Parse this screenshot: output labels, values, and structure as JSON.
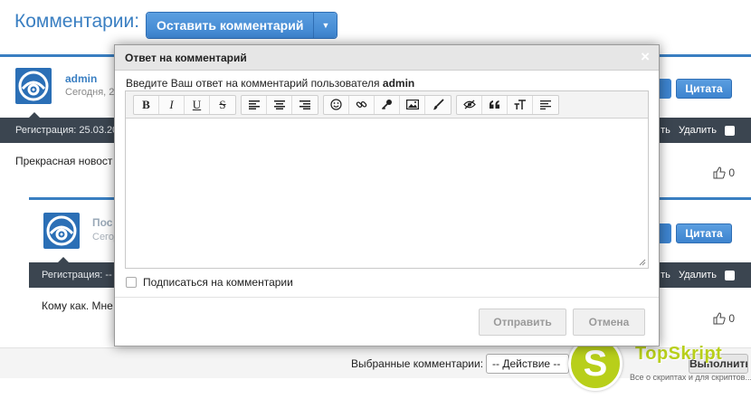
{
  "header": {
    "title": "Комментарии:",
    "add_comment_label": "Оставить комментарий"
  },
  "comments": [
    {
      "author": "admin",
      "date": "Сегодня, 2",
      "quote_label": "Цитата",
      "registration": "Регистрация: 25.03.20",
      "action_1": "ть",
      "delete_label": "Удалить",
      "text": "Прекрасная новост",
      "likes": "0"
    },
    {
      "author": "Пос",
      "date": "Сегод",
      "quote_label": "Цитата",
      "registration": "Регистрация: --",
      "action_1": "ть",
      "delete_label": "Удалить",
      "text": "Кому как. Мне",
      "likes": "0"
    }
  ],
  "bottom": {
    "selected_label": "Выбранные комментарии:",
    "action_select": "-- Действие --",
    "apply_label": "Выполнить"
  },
  "watermark": {
    "letter": "S",
    "title": "TopSkript",
    "subtitle": "Все о скриптах и для скриптов..."
  },
  "modal": {
    "title": "Ответ на комментарий",
    "close_glyph": "×",
    "prompt_prefix": "Введите Ваш ответ на комментарий пользователя",
    "prompt_user": "admin",
    "toolbar": {
      "bold": "B",
      "italic": "I",
      "underline": "U",
      "strike": "S"
    },
    "subscribe_label": "Подписаться на комментарии",
    "send_label": "Отправить",
    "cancel_label": "Отмена"
  },
  "icons": [
    "chevron-down-icon",
    "avatar-icon",
    "thumbs-up-icon",
    "align-left-icon",
    "align-center-icon",
    "align-right-icon",
    "smiley-icon",
    "link-icon",
    "key-icon",
    "image-icon",
    "brush-icon",
    "hide-icon",
    "quote-icon",
    "font-size-icon",
    "justify-icon",
    "close-icon",
    "resize-handle-icon"
  ],
  "colors": {
    "accent": "#3a7fc2",
    "info_bar": "#3b4550",
    "watermark": "#b8cf1a"
  }
}
